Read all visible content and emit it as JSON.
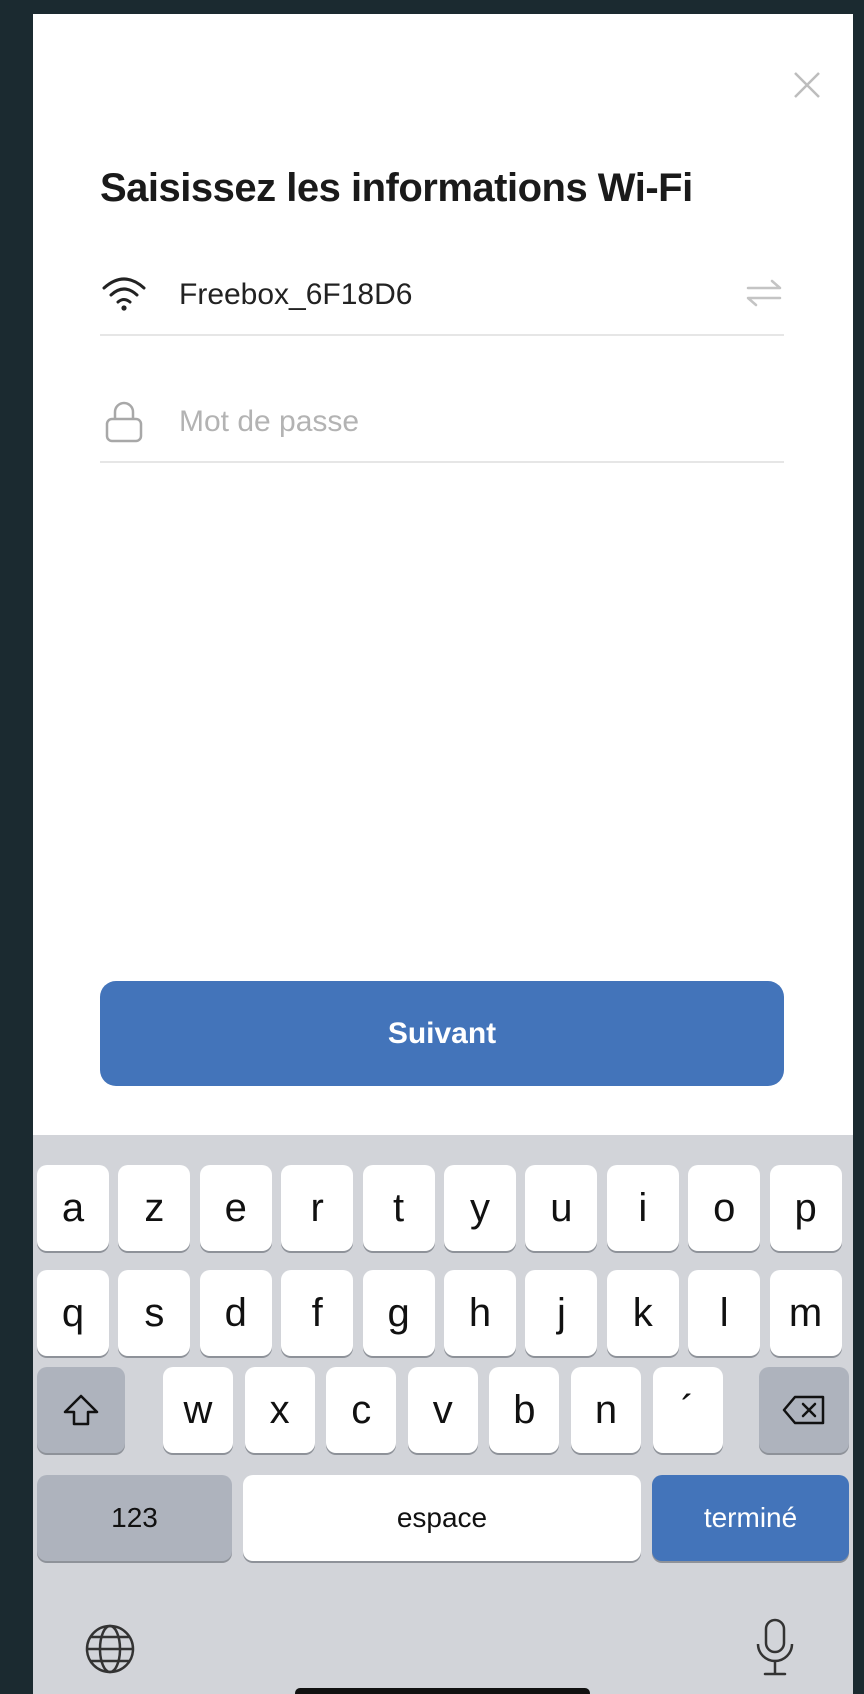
{
  "dialog": {
    "title": "Saisissez les informations Wi-Fi",
    "ssid": "Freebox_6F18D6",
    "password_placeholder": "Mot de passe",
    "next_label": "Suivant"
  },
  "icons": {
    "close": "close-icon",
    "wifi": "wifi-icon",
    "lock": "lock-icon",
    "swap": "swap-icon",
    "shift": "shift-icon",
    "backspace": "backspace-icon",
    "globe": "globe-icon",
    "mic": "microphone-icon"
  },
  "colors": {
    "accent": "#4374ba",
    "background": "#1b2a30",
    "keyboard": "#d2d4d9"
  },
  "keyboard": {
    "row1": [
      "a",
      "z",
      "e",
      "r",
      "t",
      "y",
      "u",
      "i",
      "o",
      "p"
    ],
    "row2": [
      "q",
      "s",
      "d",
      "f",
      "g",
      "h",
      "j",
      "k",
      "l",
      "m"
    ],
    "row3": [
      "w",
      "x",
      "c",
      "v",
      "b",
      "n",
      "´"
    ],
    "numbers_label": "123",
    "space_label": "espace",
    "done_label": "terminé"
  }
}
